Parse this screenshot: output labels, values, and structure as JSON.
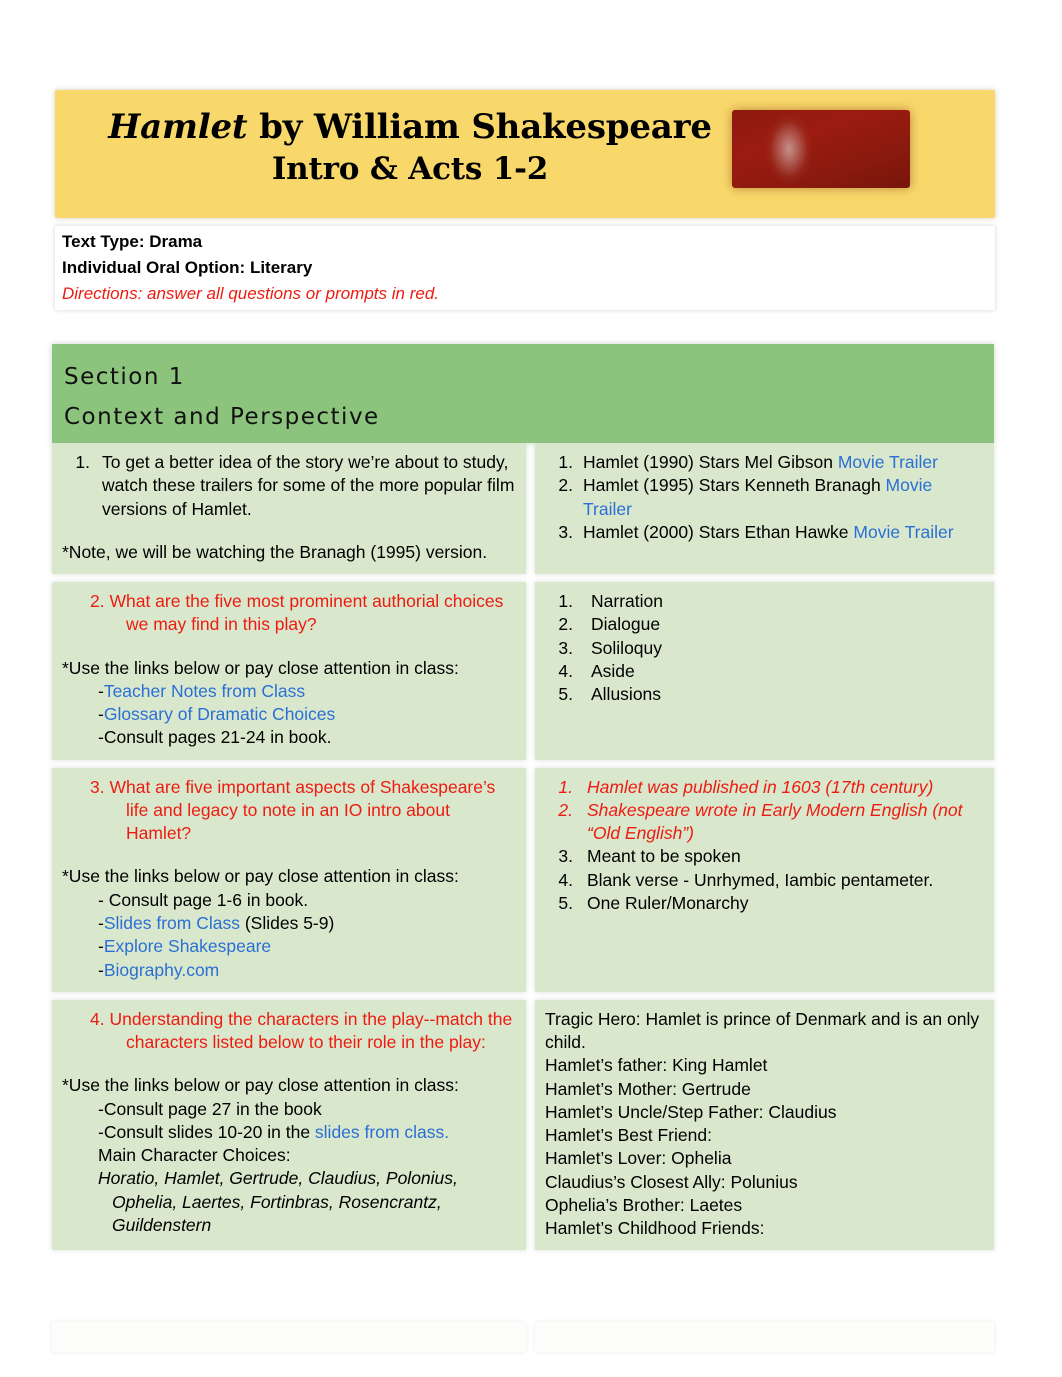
{
  "header": {
    "title_main": "Hamlet",
    "title_rest": " by William Shakespeare",
    "title_sub": "Intro & Acts 1-2",
    "image_name": "shakespeare-portrait-image",
    "banner_color": "#f8d86b",
    "image_color": "#8d1a0e"
  },
  "meta": {
    "text_type": "Text Type: Drama",
    "io_option": "Individual Oral Option: Literary",
    "directions": "Directions: answer all questions or prompts in red.",
    "directions_color": "#ee1b11"
  },
  "section": {
    "number_label": "Section 1",
    "title": "Context and Perspective",
    "header_color": "#8dc47d"
  },
  "rows": [
    {
      "left": {
        "q_num": "1.",
        "q_text": "To get a better idea of the story we’re about to study, watch these trailers for some of the more popular film versions of Hamlet.",
        "note": "*Note, we will be watching the Branagh (1995) version."
      },
      "right": {
        "items": [
          {
            "num": "1.",
            "text": "Hamlet (1990) Stars Mel Gibson ",
            "link": "Movie Trailer"
          },
          {
            "num": "2.",
            "text": "Hamlet (1995) Stars Kenneth Branagh ",
            "link": "Movie Trailer"
          },
          {
            "num": "3.",
            "text": "Hamlet (2000) Stars Ethan Hawke ",
            "link": "Movie Trailer"
          }
        ]
      }
    },
    {
      "left": {
        "q_num": "2.",
        "q_text": "2. What are the five most prominent authorial choices we may find in this play?",
        "hint": "*Use the links below or pay close attention in class:",
        "bullets": [
          {
            "dash": "-",
            "link": "Teacher Notes from Class",
            "plain": ""
          },
          {
            "dash": "-",
            "link": "Glossary of Dramatic Choices",
            "plain": ""
          },
          {
            "dash": "-",
            "link": "",
            "plain": "Consult pages 21-24 in book."
          }
        ]
      },
      "right": {
        "items": [
          {
            "num": "1.",
            "text": "Narration"
          },
          {
            "num": "2.",
            "text": "Dialogue"
          },
          {
            "num": "3.",
            "text": "Soliloquy"
          },
          {
            "num": "4.",
            "text": "Aside"
          },
          {
            "num": "5.",
            "text": "Allusions"
          }
        ]
      }
    },
    {
      "left": {
        "q_text": "3. What are five important aspects of Shakespeare’s life and legacy to note in an IO intro about Hamlet?",
        "hint": "*Use the links below or pay close attention in class:",
        "bullets": [
          {
            "dash": "- ",
            "link": "",
            "plain": "Consult page 1-6 in book."
          },
          {
            "dash": "-",
            "link": "Slides from Class",
            "plain": " (Slides 5-9)"
          },
          {
            "dash": "-",
            "link": "Explore Shakespeare",
            "plain": ""
          },
          {
            "dash": "-",
            "link": "Biography.com",
            "plain": ""
          }
        ]
      },
      "right": {
        "items": [
          {
            "num": "1.",
            "text": "Hamlet was published in 1603 (17th century)",
            "style": "red-italic"
          },
          {
            "num": "2.",
            "text": "Shakespeare wrote in Early Modern English (not “Old English”)",
            "style": "red-italic"
          },
          {
            "num": "3.",
            "text": "Meant to be spoken",
            "style": "plain"
          },
          {
            "num": "4.",
            "text": "Blank verse - Unrhymed, Iambic pentameter.",
            "style": "plain"
          },
          {
            "num": "5.",
            "text": "One Ruler/Monarchy",
            "style": "plain"
          }
        ]
      }
    },
    {
      "left": {
        "q_text": "4. Understanding the characters in the play--match the characters listed below to their role in the play:",
        "hint": "*Use the links below or pay close attention in class:",
        "bullet_1": "-Consult page 27 in the book",
        "bullet_2_pre": "-Consult slides 10-20 in the ",
        "bullet_2_link": "slides from class.",
        "choices_label": "Main Character Choices:",
        "choices": "Horatio, Hamlet, Gertrude, Claudius, Polonius, Ophelia, Laertes, Fortinbras, Rosencrantz, Guildenstern"
      },
      "right": {
        "lines": [
          "Tragic Hero: Hamlet is prince of Denmark and is an only child.",
          "Hamlet’s father: King Hamlet",
          "Hamlet’s Mother: Gertrude",
          "Hamlet’s Uncle/Step Father: Claudius",
          "Hamlet’s Best Friend:",
          "Hamlet’s Lover:  Ophelia",
          "Claudius’s Closest Ally: Polunius",
          "Ophelia’s Brother: Laetes",
          "Hamlet’s Childhood Friends:"
        ]
      }
    }
  ],
  "colors": {
    "link": "#2b6fd4",
    "red": "#ee1b11",
    "cell_bg": "#d9e8cd",
    "section_bg": "#8dc47d"
  }
}
